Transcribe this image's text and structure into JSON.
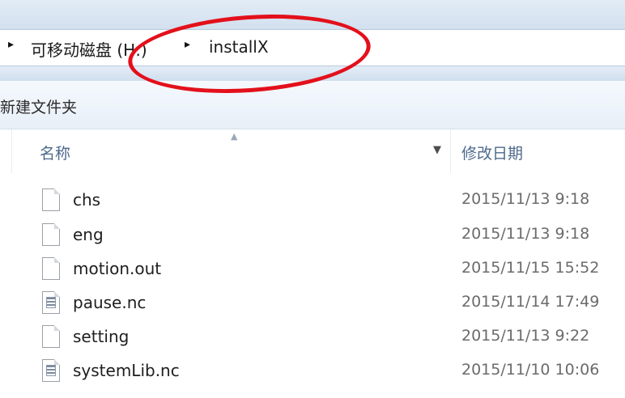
{
  "address_bar": {
    "segments": [
      {
        "label": "可移动磁盘 (H:)"
      },
      {
        "label": "installX"
      }
    ]
  },
  "toolbar": {
    "new_folder_label": "新建文件夹"
  },
  "columns": {
    "name_label": "名称",
    "date_label": "修改日期"
  },
  "files": [
    {
      "name": "chs",
      "date": "2015/11/13 9:18",
      "icon": "blank-file-icon"
    },
    {
      "name": "eng",
      "date": "2015/11/13 9:18",
      "icon": "blank-file-icon"
    },
    {
      "name": "motion.out",
      "date": "2015/11/15 15:52",
      "icon": "blank-file-icon"
    },
    {
      "name": "pause.nc",
      "date": "2015/11/14 17:49",
      "icon": "nc-file-icon"
    },
    {
      "name": "setting",
      "date": "2015/11/13 9:22",
      "icon": "blank-file-icon"
    },
    {
      "name": "systemLib.nc",
      "date": "2015/11/10 10:06",
      "icon": "nc-file-icon"
    }
  ],
  "annotation": {
    "color": "#e3101b"
  }
}
